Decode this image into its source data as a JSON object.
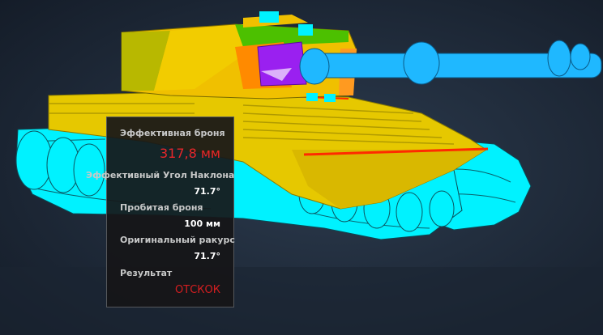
{
  "scene": {
    "background": "#1c2838",
    "hull_color": "#e6c800",
    "track_color": "#00f2ff",
    "gun_color": "#1fb8ff",
    "mantlet_color": "#9a20f0",
    "hot_color": "#ff2a00"
  },
  "tooltip": {
    "effective_armor_label": "Эффективная броня",
    "effective_armor_value": "317,8 мм",
    "effective_angle_label": "Эффективный Угол Наклона",
    "effective_angle_value": "71.7°",
    "penetration_label": "Пробитая броня",
    "penetration_value": "100 мм",
    "original_angle_label": "Оригинальный ракурс",
    "original_angle_value": "71.7°",
    "result_label": "Результат",
    "result_value": "ОТСКОК"
  }
}
